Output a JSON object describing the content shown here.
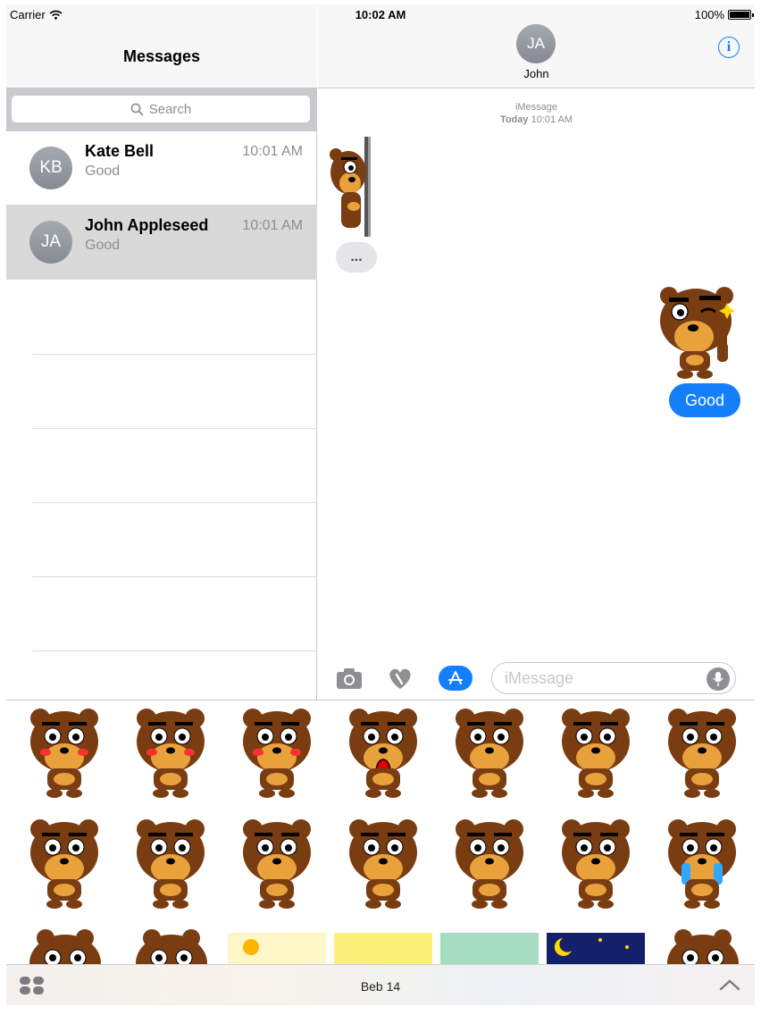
{
  "status_bar": {
    "carrier": "Carrier",
    "time": "10:02 AM",
    "battery": "100%"
  },
  "left_pane": {
    "title": "Messages",
    "search_placeholder": "Search",
    "conversations": [
      {
        "initials": "KB",
        "name": "Kate Bell",
        "preview": "Good",
        "time": "10:01 AM",
        "selected": false
      },
      {
        "initials": "JA",
        "name": "John Appleseed",
        "preview": "Good",
        "time": "10:01 AM",
        "selected": true
      }
    ]
  },
  "conversation": {
    "contact_initials": "JA",
    "contact_name": "John",
    "service": "iMessage",
    "timestamp_day": "Today",
    "timestamp_time": "10:01 AM",
    "typing_indicator": "...",
    "outgoing_message": "Good"
  },
  "composer": {
    "placeholder": "iMessage"
  },
  "sticker_pack": {
    "name": "Beb 14",
    "stickers": [
      "blushing-bear",
      "happy-blush-bear",
      "shy-bear",
      "shocked-bear",
      "stunned-bear",
      "dizzy-bear",
      "flying-bear",
      "fallen-bear",
      "thumbs-up-bear",
      "shrug-bear",
      "thinking-bear",
      "sleeping-bear",
      "dancing-bear",
      "crying-bear",
      "bear",
      "bear",
      "sunny-bear",
      "yellow-bear",
      "green-bear",
      "night-bear",
      "bear"
    ]
  },
  "colors": {
    "accent": "#147efb",
    "bear_fur": "#7a3d12",
    "bear_muzzle": "#e9a23b",
    "selected_row": "#d9d9d9"
  }
}
